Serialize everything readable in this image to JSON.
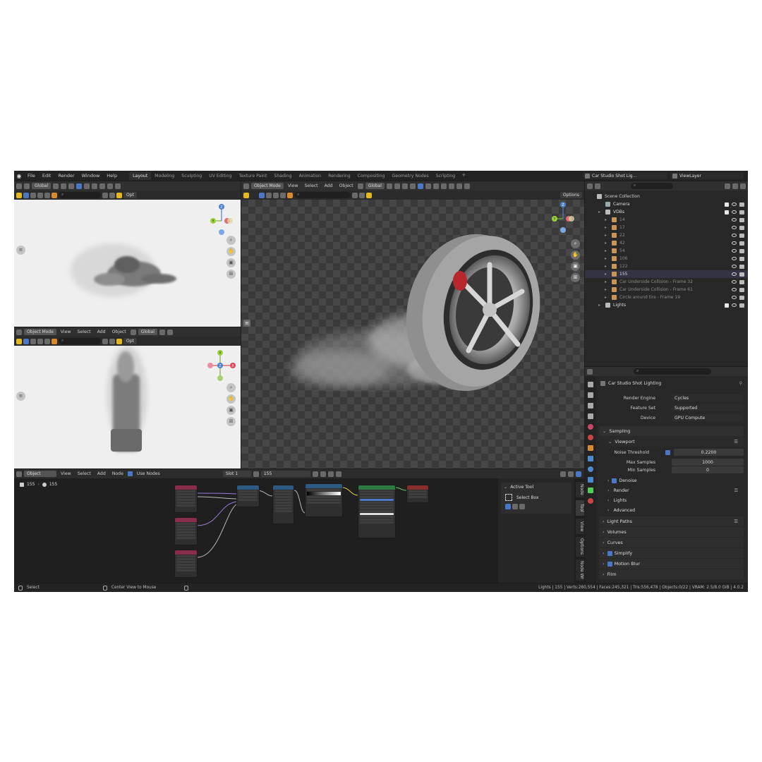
{
  "menu": [
    "File",
    "Edit",
    "Render",
    "Window",
    "Help"
  ],
  "workspaces": [
    "Layout",
    "Modeling",
    "Sculpting",
    "UV Editing",
    "Texture Paint",
    "Shading",
    "Animation",
    "Rendering",
    "Compositing",
    "Geometry Nodes",
    "Scripting"
  ],
  "active_workspace": "Layout",
  "scene_name": "Car Studio Shot Lig...",
  "view_layer": "ViewLayer",
  "viewport_left_top": {
    "orientation": "Global",
    "options": "Opt"
  },
  "viewport_left_bottom": {
    "mode": "Object Mode",
    "menus": [
      "View",
      "Select",
      "Add",
      "Object"
    ],
    "orientation": "Global",
    "options": "Opt"
  },
  "viewport_main": {
    "mode": "Object Mode",
    "menus": [
      "View",
      "Select",
      "Add",
      "Object"
    ],
    "orientation": "Global",
    "options": "Options"
  },
  "gizmo_labels": {
    "z": "Z",
    "y": "Y",
    "x": "X"
  },
  "outliner": {
    "root": "Scene Collection",
    "rows": [
      {
        "label": "Camera",
        "indent": 1
      },
      {
        "label": "VDBs",
        "indent": 1
      },
      {
        "label": "14",
        "indent": 2
      },
      {
        "label": "17",
        "indent": 2
      },
      {
        "label": "22",
        "indent": 2
      },
      {
        "label": "42",
        "indent": 2
      },
      {
        "label": "54",
        "indent": 2
      },
      {
        "label": "106",
        "indent": 2
      },
      {
        "label": "122",
        "indent": 2
      },
      {
        "label": "155",
        "indent": 2
      },
      {
        "label": "Car Underside Collision - Frame 32",
        "indent": 2
      },
      {
        "label": "Car Underside Collision - Frame 61",
        "indent": 2
      },
      {
        "label": "Circle around tire - Frame 19",
        "indent": 2
      },
      {
        "label": "Lights",
        "indent": 1
      }
    ]
  },
  "properties": {
    "scene": "Car Studio Shot Lighting",
    "render_engine_label": "Render Engine",
    "render_engine": "Cycles",
    "feature_set_label": "Feature Set",
    "feature_set": "Supported",
    "device_label": "Device",
    "device": "GPU Compute",
    "sampling": "Sampling",
    "viewport": "Viewport",
    "noise_threshold_label": "Noise Threshold",
    "noise_threshold": "0.2200",
    "max_samples_label": "Max Samples",
    "max_samples": "1000",
    "min_samples_label": "Min Samples",
    "min_samples": "0",
    "denoise": "Denoise",
    "render": "Render",
    "lights": "Lights",
    "advanced": "Advanced",
    "panels": [
      "Light Paths",
      "Volumes",
      "Curves",
      "Simplify",
      "Motion Blur",
      "Film"
    ]
  },
  "node_editor": {
    "type": "Object",
    "menus": [
      "View",
      "Select",
      "Add",
      "Node"
    ],
    "use_nodes": "Use Nodes",
    "slot": "Slot 1",
    "material": "155",
    "breadcrumb_object": "155",
    "breadcrumb_material": "155",
    "active_tool": "Active Tool",
    "select_box": "Select Box",
    "tabs": [
      "Node",
      "Tool",
      "View",
      "Options",
      "Node Wr"
    ]
  },
  "status": {
    "select": "Select",
    "center": "Center View to Mouse",
    "stats": "Lights | 155 | Verts:280,554 | Faces:245,321 | Tris:556,478 | Objects:0/22 | VRAM: 2.5/8.0 GiB | 4.0.2"
  }
}
